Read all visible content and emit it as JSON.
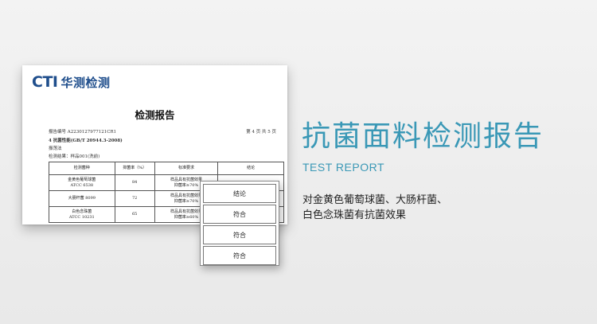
{
  "brand": {
    "latin": "CTI",
    "chinese": "华测检测"
  },
  "report": {
    "title": "检测报告",
    "report_no": "报告编号  A2230127977121CR1",
    "page_info": "第 4 页  共 5 页",
    "section": "4    抗菌性能(GB/T 20944.3-2008)",
    "method": "振荡法",
    "result_line": "检测结果：样品001(洗前)",
    "table": {
      "headers": [
        "检测菌种",
        "抑菌率（%）",
        "标准要求",
        "结论"
      ],
      "rows": [
        {
          "strain": [
            "金黄色葡萄球菌",
            "ATCC 6538"
          ],
          "rate": "84",
          "requirement": [
            "样品具有抗菌效果",
            "抑菌率≥70%"
          ],
          "conclusion": ""
        },
        {
          "strain": [
            "大肠杆菌  8099"
          ],
          "rate": "72",
          "requirement": [
            "样品具有抗菌效果",
            "抑菌率≥70%"
          ],
          "conclusion": ""
        },
        {
          "strain": [
            "白色念珠菌",
            "ATCC 10231"
          ],
          "rate": "65",
          "requirement": [
            "样品具有抗菌效果",
            "抑菌率≥60%"
          ],
          "conclusion": ""
        }
      ]
    }
  },
  "conclusion_box": {
    "header": "结论",
    "items": [
      "符合",
      "符合",
      "符合"
    ]
  },
  "heading": {
    "title": "抗菌面料检测报告",
    "subtitle": "TEST REPORT",
    "description_line1": "对金黄色葡萄球菌、大肠杆菌、",
    "description_line2": "白色念珠菌有抗菌效果"
  },
  "colors": {
    "accent": "#3a98b6",
    "brand_blue": "#1f4e8c",
    "brand_dot": "#e9a21c"
  }
}
